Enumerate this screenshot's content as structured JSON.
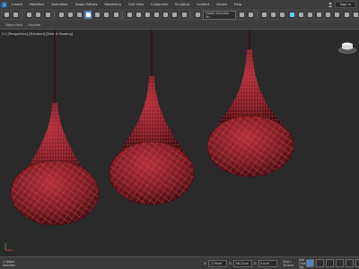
{
  "menubar": {
    "items": [
      "Create",
      "Modifiers",
      "Animation",
      "Graph Editors",
      "Rendering",
      "Civil View",
      "Customize",
      "Scripting",
      "Content",
      "Arnold",
      "Help"
    ],
    "signin_label": "Sign In"
  },
  "toolbar": {
    "selection_set_placeholder": "Create Selection Se..."
  },
  "ribbon": {
    "labels": [
      "Object Paint",
      "Populate"
    ]
  },
  "viewport": {
    "label": "[+] [Perspective] [Standard] [Default Shading]"
  },
  "statusbar": {
    "left_text": "1 Object Selected",
    "x_value": "-2.39cm",
    "y_value": "-58.12cm",
    "z_value": "0.0cm",
    "grid_label": "Grid = 10.0cm",
    "add_time_tag": "Add Time Tag"
  },
  "colors": {
    "lamp_fill": "#7b1f24",
    "lamp_line": "#d23a45",
    "background": "#2a2a2a"
  }
}
